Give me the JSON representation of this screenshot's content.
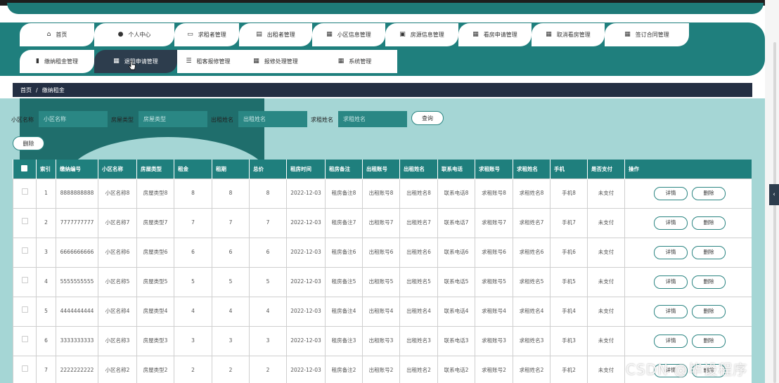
{
  "nav": {
    "row1": [
      {
        "label": "首页",
        "icon": "home-icon",
        "glyph": "⌂"
      },
      {
        "label": "个人中心",
        "icon": "user-icon",
        "glyph": "●"
      },
      {
        "label": "求租者管理",
        "icon": "chat-icon",
        "glyph": "▭"
      },
      {
        "label": "出租者管理",
        "icon": "id-card-icon",
        "glyph": "▤"
      },
      {
        "label": "小区信息管理",
        "icon": "grid-icon",
        "glyph": "▦"
      },
      {
        "label": "房源信息管理",
        "icon": "briefcase-icon",
        "glyph": "▣"
      },
      {
        "label": "看房申请管理",
        "icon": "grid-icon",
        "glyph": "▦"
      },
      {
        "label": "取消看房管理",
        "icon": "grid-icon",
        "glyph": "▦"
      },
      {
        "label": "签订合同管理",
        "icon": "grid-icon",
        "glyph": "▦"
      }
    ],
    "row2": [
      {
        "label": "缴纳租金管理",
        "icon": "bar-chart-icon",
        "glyph": "▮"
      },
      {
        "label": "退租申请管理",
        "icon": "grid-icon",
        "glyph": "▦"
      },
      {
        "label": "租客报修管理",
        "icon": "sliders-icon",
        "glyph": "☰"
      },
      {
        "label": "报修处理管理",
        "icon": "grid-icon",
        "glyph": "▦"
      },
      {
        "label": "系统管理",
        "icon": "grid-icon",
        "glyph": "▦"
      }
    ]
  },
  "breadcrumb": {
    "home": "首页",
    "sep": "/",
    "current": "缴纳租金"
  },
  "search": {
    "fields": [
      {
        "label": "小区名称",
        "placeholder": "小区名称"
      },
      {
        "label": "房屋类型",
        "placeholder": "房屋类型"
      },
      {
        "label": "出租姓名",
        "placeholder": "出租姓名"
      },
      {
        "label": "求租姓名",
        "placeholder": "求租姓名"
      }
    ],
    "query_label": "查询",
    "delete_label": "删除"
  },
  "table": {
    "headers": [
      "索引",
      "缴纳编号",
      "小区名称",
      "房屋类型",
      "租金",
      "租期",
      "总价",
      "租房时间",
      "租房备注",
      "出租账号",
      "出租姓名",
      "联系电话",
      "求租账号",
      "求租姓名",
      "手机",
      "是否支付",
      "操作"
    ],
    "detail_label": "详情",
    "delete_label": "删除",
    "rows": [
      [
        "1",
        "8888888888",
        "小区名称8",
        "房屋类型8",
        "8",
        "8",
        "8",
        "2022-12-03",
        "租房备注8",
        "出租账号8",
        "出租姓名8",
        "联系电话8",
        "求租账号8",
        "求租姓名8",
        "手机8",
        "未支付"
      ],
      [
        "2",
        "7777777777",
        "小区名称7",
        "房屋类型7",
        "7",
        "7",
        "7",
        "2022-12-03",
        "租房备注7",
        "出租账号7",
        "出租姓名7",
        "联系电话7",
        "求租账号7",
        "求租姓名7",
        "手机7",
        "未支付"
      ],
      [
        "3",
        "6666666666",
        "小区名称6",
        "房屋类型6",
        "6",
        "6",
        "6",
        "2022-12-03",
        "租房备注6",
        "出租账号6",
        "出租姓名6",
        "联系电话6",
        "求租账号6",
        "求租姓名6",
        "手机6",
        "未支付"
      ],
      [
        "4",
        "5555555555",
        "小区名称5",
        "房屋类型5",
        "5",
        "5",
        "5",
        "2022-12-03",
        "租房备注5",
        "出租账号5",
        "出租姓名5",
        "联系电话5",
        "求租账号5",
        "求租姓名5",
        "手机5",
        "未支付"
      ],
      [
        "5",
        "4444444444",
        "小区名称4",
        "房屋类型4",
        "4",
        "4",
        "4",
        "2022-12-03",
        "租房备注4",
        "出租账号4",
        "出租姓名4",
        "联系电话4",
        "求租账号4",
        "求租姓名4",
        "手机4",
        "未支付"
      ],
      [
        "6",
        "3333333333",
        "小区名称3",
        "房屋类型3",
        "3",
        "3",
        "3",
        "2022-12-03",
        "租房备注3",
        "出租账号3",
        "出租姓名3",
        "联系电话3",
        "求租账号3",
        "求租姓名3",
        "手机3",
        "未支付"
      ],
      [
        "7",
        "2222222222",
        "小区名称2",
        "房屋类型2",
        "2",
        "2",
        "2",
        "2022-12-03",
        "租房备注2",
        "出租账号2",
        "出租姓名2",
        "联系电话2",
        "求租账号2",
        "求租姓名2",
        "手机2",
        "未支付"
      ]
    ]
  },
  "watermark": "CSDN @毕设程序",
  "colors": {
    "primary": "#1f7f7d",
    "content_bg": "#a5d6d5",
    "dark": "#242f43"
  }
}
